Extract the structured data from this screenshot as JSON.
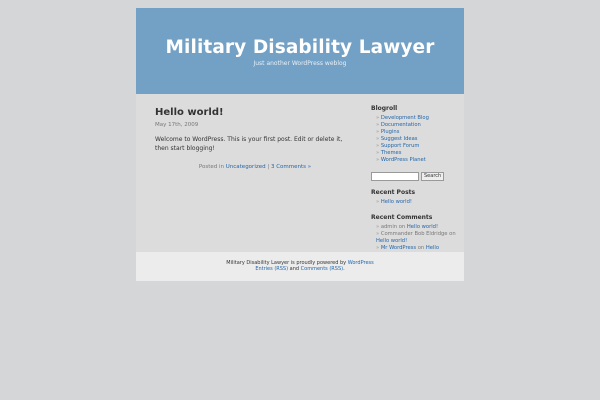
{
  "header": {
    "title": "Military Disability Lawyer",
    "description": "Just another WordPress weblog"
  },
  "post": {
    "title": "Hello world!",
    "date": "May 17th, 2009",
    "body": "Welcome to WordPress. This is your first post. Edit or delete it, then start blogging!",
    "posted_in": "Posted in",
    "category": "Uncategorized",
    "separator": "|",
    "comments": "3 Comments »"
  },
  "sidebar": {
    "blogroll_heading": "Blogroll",
    "blogroll": [
      "Development Blog",
      "Documentation",
      "Plugins",
      "Suggest Ideas",
      "Support Forum",
      "Themes",
      "WordPress Planet"
    ],
    "search": {
      "value": "",
      "button": "Search"
    },
    "recent_posts_heading": "Recent Posts",
    "recent_posts": [
      "Hello world!"
    ],
    "recent_comments_heading": "Recent Comments",
    "recent_comments": [
      {
        "author": "admin",
        "on": "on",
        "post": "Hello world!"
      },
      {
        "author": "Commander Bob Eldridge",
        "on": "on",
        "post": "Hello world!"
      },
      {
        "author": "Mr WordPress",
        "on": "on",
        "post": "Hello world!"
      }
    ]
  },
  "footer": {
    "powered_text": "Military Disability Lawyer is proudly powered by",
    "wordpress_link": "WordPress",
    "entries_rss": "Entries (RSS)",
    "and": "and",
    "comments_rss": "Comments (RSS)",
    "period": "."
  },
  "colors": {
    "header_bg": "#73a0c5",
    "page_bg": "#dcdcdc",
    "body_bg": "#d5d6d7",
    "link": "#2266aa"
  }
}
